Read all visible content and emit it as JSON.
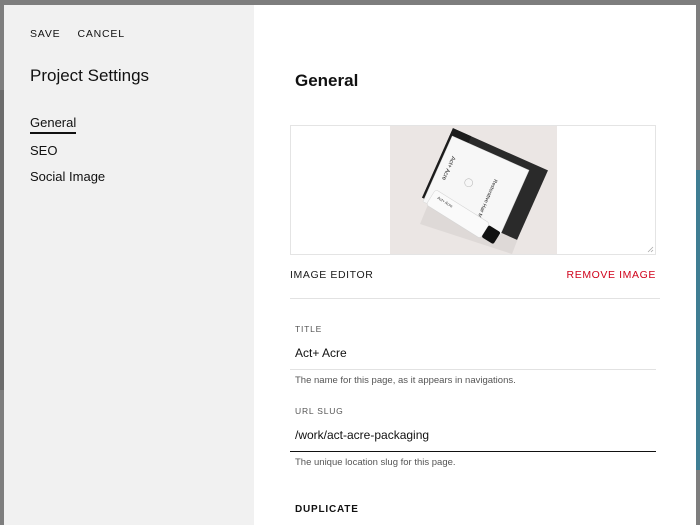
{
  "sidebar": {
    "actions": {
      "save": "SAVE",
      "cancel": "CANCEL"
    },
    "title": "Project Settings",
    "nav": [
      {
        "label": "General",
        "active": true
      },
      {
        "label": "SEO",
        "active": false
      },
      {
        "label": "Social Image",
        "active": false
      }
    ]
  },
  "main": {
    "title": "General",
    "image": {
      "editor_label": "IMAGE EDITOR",
      "remove_label": "REMOVE IMAGE",
      "box_text": "Act+ Acre",
      "tube_text": "Act+ Acre",
      "product_text": "Restorative Hair Mask"
    },
    "fields": {
      "title": {
        "label": "TITLE",
        "value": "Act+ Acre",
        "help": "The name for this page, as it appears in navigations."
      },
      "url_slug": {
        "label": "URL SLUG",
        "value": "/work/act-acre-packaging",
        "help": "The unique location slug for this page."
      }
    },
    "duplicate_label": "DUPLICATE"
  },
  "colors": {
    "danger": "#d0021b",
    "sidebar_bg": "#f1f1f1"
  }
}
